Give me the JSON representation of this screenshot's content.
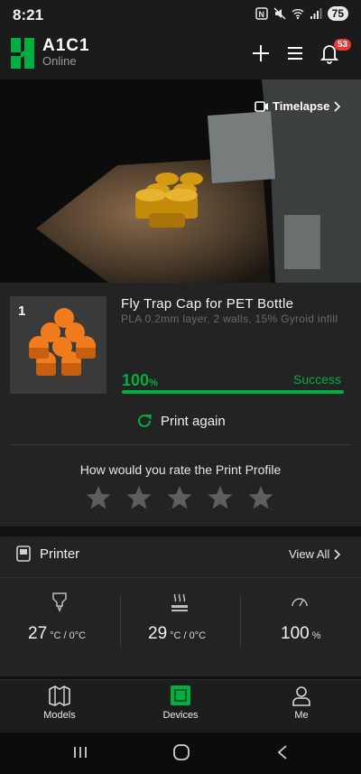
{
  "status_bar": {
    "time": "8:21",
    "battery": "75"
  },
  "header": {
    "title": "A1C1",
    "status": "Online",
    "notification_count": "53"
  },
  "camera": {
    "timelapse_label": "Timelapse"
  },
  "print_job": {
    "plate_number": "1",
    "model_name": "Fly Trap Cap for PET Bottle",
    "description": "PLA 0.2mm layer, 2 walls, 15% Gyroid infill",
    "progress_value": "100",
    "progress_unit": "%",
    "progress_fraction": 1.0,
    "status": "Success",
    "print_again_label": "Print again"
  },
  "rating": {
    "question": "How would you rate the Print Profile",
    "stars": 5
  },
  "printer": {
    "title": "Printer",
    "view_all_label": "View All",
    "nozzle_temp": "27",
    "nozzle_unit": "°C / 0°C",
    "bed_temp": "29",
    "bed_unit": "°C / 0°C",
    "fan_speed": "100",
    "fan_unit": "%"
  },
  "bottom_nav": {
    "models_label": "Models",
    "devices_label": "Devices",
    "me_label": "Me"
  },
  "colors": {
    "accent": "#00ae42",
    "badge": "#e53935",
    "card": "#232323"
  }
}
